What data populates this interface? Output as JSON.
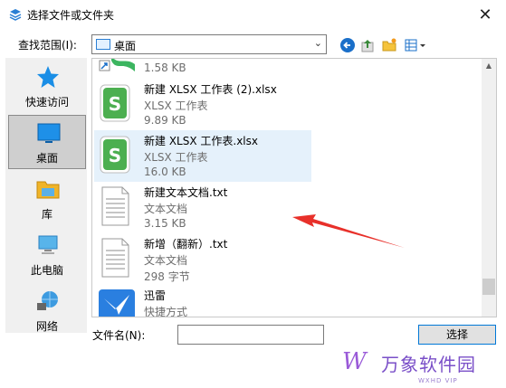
{
  "window": {
    "title": "选择文件或文件夹"
  },
  "lookin": {
    "label": "查找范围(I):",
    "value": "桌面"
  },
  "places": [
    {
      "label": "快速访问",
      "icon": "star-icon"
    },
    {
      "label": "桌面",
      "icon": "desktop-icon"
    },
    {
      "label": "库",
      "icon": "library-icon"
    },
    {
      "label": "此电脑",
      "icon": "computer-icon"
    },
    {
      "label": "网络",
      "icon": "network-icon"
    }
  ],
  "files": [
    {
      "name": "",
      "type": "",
      "size": "1.58 KB",
      "icon": "shortcut-icon"
    },
    {
      "name": "新建 XLSX 工作表 (2).xlsx",
      "type": "XLSX 工作表",
      "size": "9.89 KB",
      "icon": "spreadsheet-icon"
    },
    {
      "name": "新建 XLSX 工作表.xlsx",
      "type": "XLSX 工作表",
      "size": "16.0 KB",
      "icon": "spreadsheet-icon"
    },
    {
      "name": "新建文本文档.txt",
      "type": "文本文档",
      "size": "3.15 KB",
      "icon": "text-document-icon"
    },
    {
      "name": "新增（翻新）.txt",
      "type": "文本文档",
      "size": "298 字节",
      "icon": "text-document-icon"
    },
    {
      "name": "迅雷",
      "type": "快捷方式",
      "size": "",
      "icon": "thunder-icon"
    }
  ],
  "filename": {
    "label": "文件名(N):",
    "value": ""
  },
  "buttons": {
    "select": "选择"
  },
  "watermark": {
    "logo": "W",
    "name": "万象软件园",
    "sub": "WXHD VIP"
  },
  "colors": {
    "accent": "#0078d7",
    "selection": "#e5f1fb",
    "sheet_green": "#4caf50",
    "annotation_red": "#e8302a"
  }
}
